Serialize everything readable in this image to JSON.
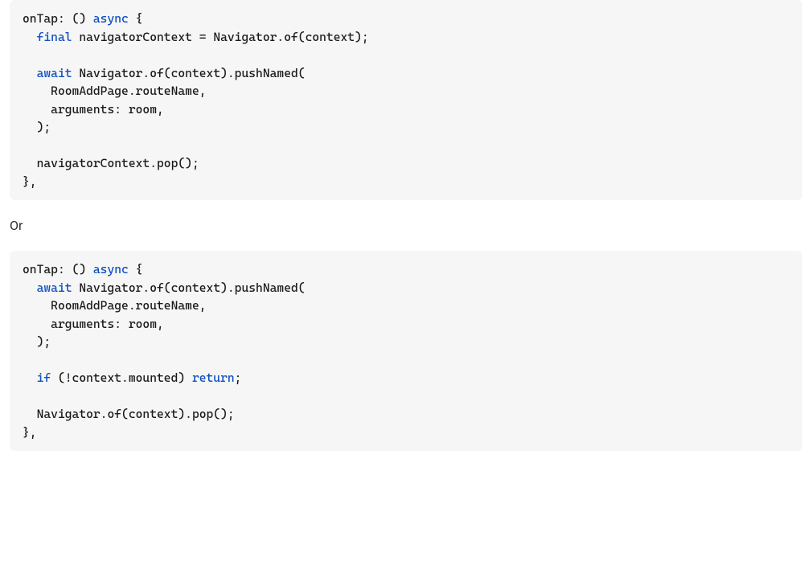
{
  "separator": "Or",
  "code1": {
    "l1_a": "onTap: () ",
    "l1_b": "async",
    "l1_c": " {",
    "l2_a": "  ",
    "l2_b": "final",
    "l2_c": " navigatorContext = Navigator.of(context);",
    "l3": "",
    "l4_a": "  ",
    "l4_b": "await",
    "l4_c": " Navigator.of(context).pushNamed(",
    "l5": "    RoomAddPage.routeName,",
    "l6": "    arguments: room,",
    "l7": "  );",
    "l8": "",
    "l9": "  navigatorContext.pop();",
    "l10": "},"
  },
  "code2": {
    "l1_a": "onTap: () ",
    "l1_b": "async",
    "l1_c": " {",
    "l2_a": "  ",
    "l2_b": "await",
    "l2_c": " Navigator.of(context).pushNamed(",
    "l3": "    RoomAddPage.routeName,",
    "l4": "    arguments: room,",
    "l5": "  );",
    "l6": "",
    "l7_a": "  ",
    "l7_b": "if",
    "l7_c": " (!context.mounted) ",
    "l7_d": "return",
    "l7_e": ";",
    "l8": "",
    "l9": "  Navigator.of(context).pop();",
    "l10": "},"
  }
}
